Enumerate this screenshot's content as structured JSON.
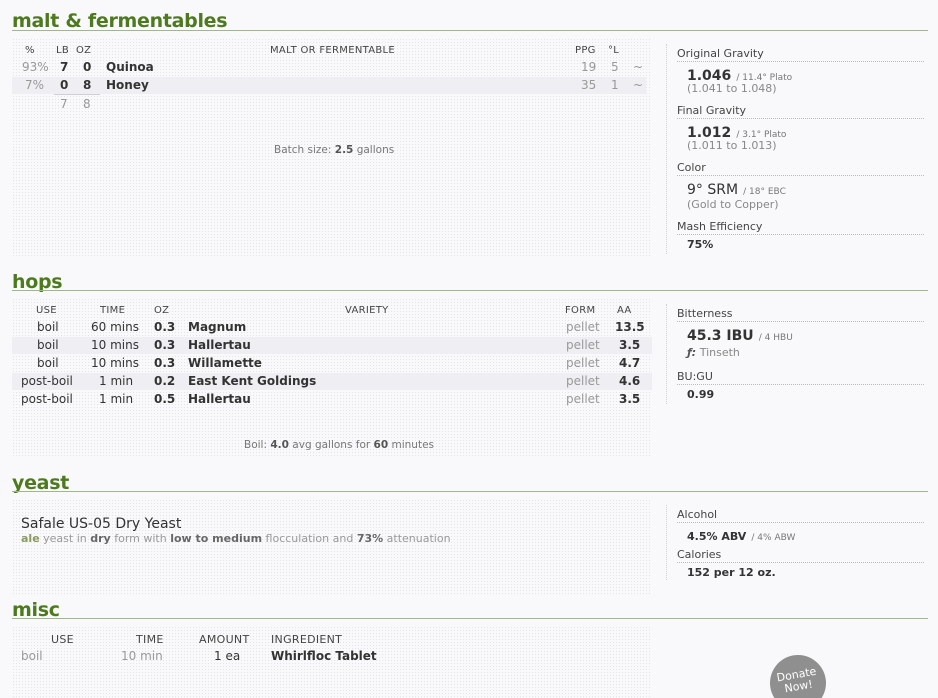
{
  "malt": {
    "title": "malt & fermentables",
    "headers": {
      "pct": "%",
      "lb": "LB",
      "oz": "OZ",
      "name": "MALT OR FERMENTABLE",
      "ppg": "PPG",
      "lov": "°L"
    },
    "rows": [
      {
        "pct": "93%",
        "lb": "7",
        "oz": "0",
        "name": "Quinoa",
        "ppg": "19",
        "lov": "5",
        "tilde": "~"
      },
      {
        "pct": "7%",
        "lb": "0",
        "oz": "8",
        "name": "Honey",
        "ppg": "35",
        "lov": "1",
        "tilde": "~"
      }
    ],
    "total_lb": "7",
    "total_oz": "8",
    "batch_prefix": "Batch size: ",
    "batch_value": "2.5",
    "batch_suffix": " gallons"
  },
  "malt_stats": {
    "og_label": "Original Gravity",
    "og_value": "1.046",
    "og_plato": "/ 11.4° Plato",
    "og_range": "(1.041 to 1.048)",
    "fg_label": "Final Gravity",
    "fg_value": "1.012",
    "fg_plato": "/ 3.1° Plato",
    "fg_range": "(1.011 to 1.013)",
    "color_label": "Color",
    "color_value": "9° SRM",
    "color_ebc": "/ 18° EBC",
    "color_desc": "(Gold to Copper)",
    "mash_label": "Mash Efficiency",
    "mash_value": "75%"
  },
  "hops": {
    "title": "hops",
    "headers": {
      "use": "USE",
      "time": "TIME",
      "oz": "OZ",
      "variety": "VARIETY",
      "form": "FORM",
      "aa": "AA"
    },
    "rows": [
      {
        "use": "boil",
        "time": "60 mins",
        "oz": "0.3",
        "variety": "Magnum",
        "form": "pellet",
        "aa": "13.5"
      },
      {
        "use": "boil",
        "time": "10 mins",
        "oz": "0.3",
        "variety": "Hallertau",
        "form": "pellet",
        "aa": "3.5"
      },
      {
        "use": "boil",
        "time": "10 mins",
        "oz": "0.3",
        "variety": "Willamette",
        "form": "pellet",
        "aa": "4.7"
      },
      {
        "use": "post-boil",
        "time": "1 min",
        "oz": "0.2",
        "variety": "East Kent Goldings",
        "form": "pellet",
        "aa": "4.6"
      },
      {
        "use": "post-boil",
        "time": "1 min",
        "oz": "0.5",
        "variety": "Hallertau",
        "form": "pellet",
        "aa": "3.5"
      }
    ],
    "boil_prefix": "Boil: ",
    "boil_gallons": "4.0",
    "boil_mid": " avg gallons for ",
    "boil_minutes": "60",
    "boil_suffix": " minutes"
  },
  "hop_stats": {
    "bitterness_label": "Bitterness",
    "ibu_value": "45.3 IBU",
    "hbu": "/ 4 HBU",
    "formula_symbol": "ƒ:",
    "formula": "Tinseth",
    "bugu_label": "BU:GU",
    "bugu_value": "0.99"
  },
  "yeast": {
    "title": "yeast",
    "name": "Safale US-05 Dry Yeast",
    "kind": "ale",
    "t1": " yeast in ",
    "form": "dry",
    "t2": " form with ",
    "floc": "low to medium",
    "t3": " flocculation and ",
    "atten": "73%",
    "t4": " attenuation"
  },
  "yeast_stats": {
    "alcohol_label": "Alcohol",
    "abv": "4.5% ABV",
    "abw": "/ 4% ABW",
    "calories_label": "Calories",
    "calories_value": "152 per 12 oz."
  },
  "misc": {
    "title": "misc",
    "headers": {
      "use": "USE",
      "time": "TIME",
      "amount": "AMOUNT",
      "ingredient": "INGREDIENT"
    },
    "rows": [
      {
        "use": "boil",
        "time": "10 min",
        "amount": "1 ea",
        "ingredient": "Whirlfloc Tablet"
      }
    ]
  },
  "donate": {
    "line1": "Donate",
    "line2": "Now!"
  },
  "colors": {
    "accent": "#4e7a1f",
    "rule": "#9fb88a"
  }
}
